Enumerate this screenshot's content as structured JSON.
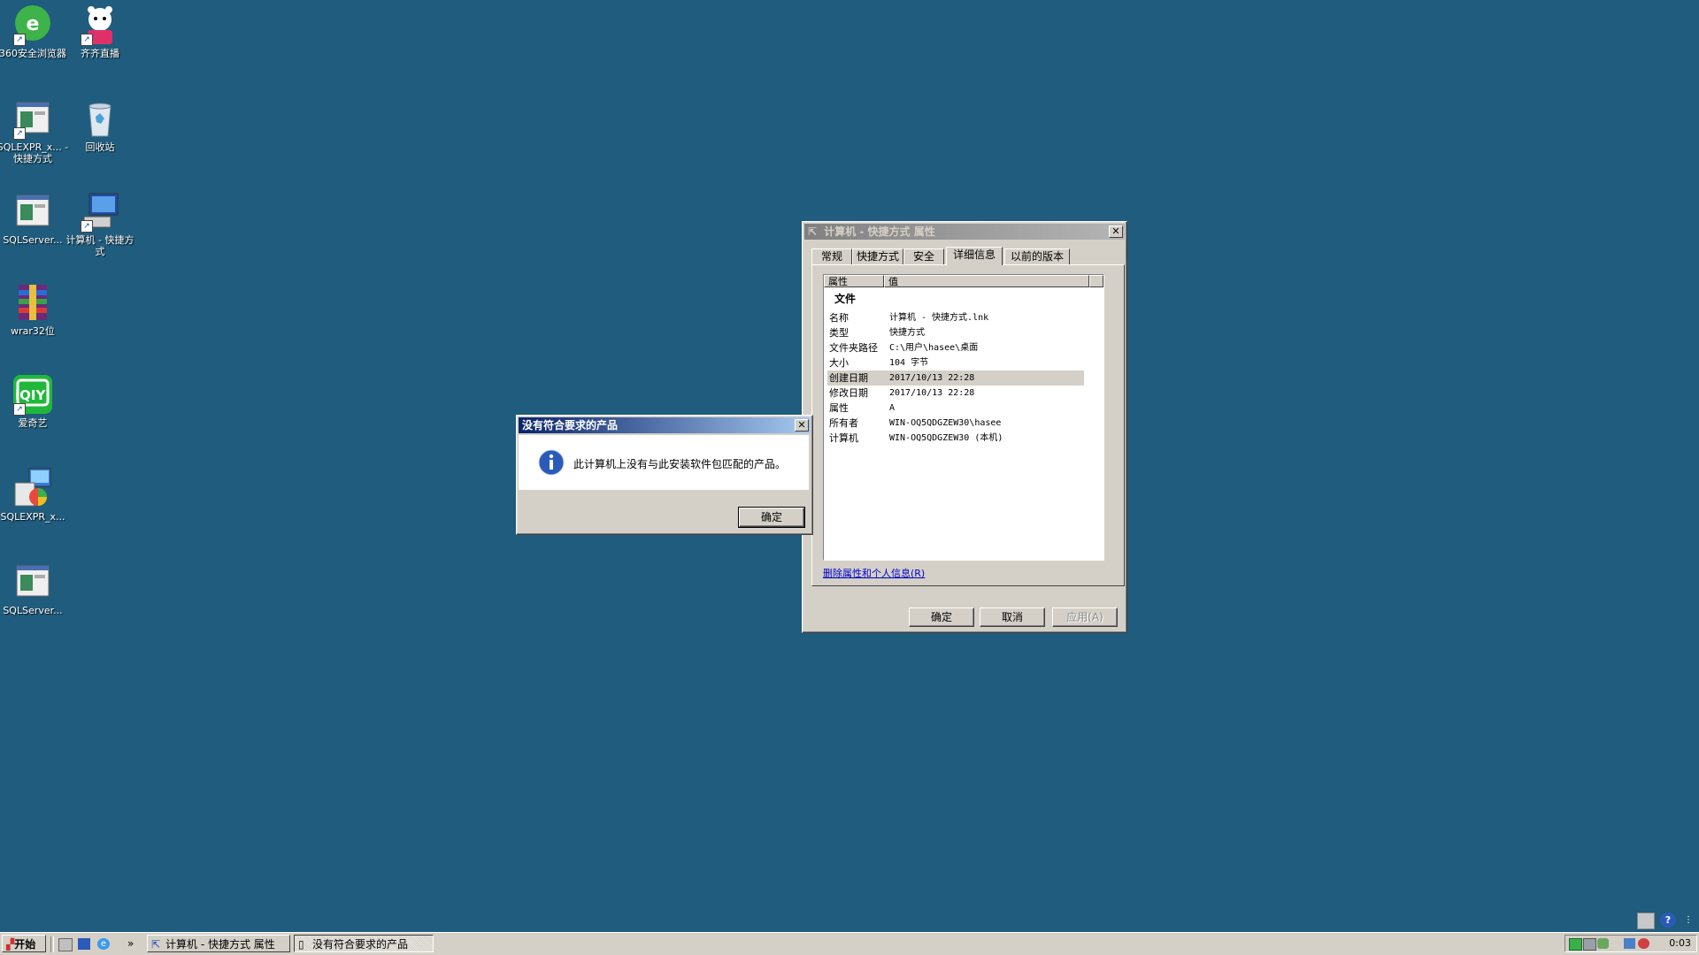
{
  "desktop": {
    "icons": [
      {
        "label": "360安全浏览器"
      },
      {
        "label": "齐齐直播"
      },
      {
        "label": "SQLEXPR_x... - 快捷方式"
      },
      {
        "label": "回收站"
      },
      {
        "label": "SQLServer..."
      },
      {
        "label": "计算机 - 快捷方式"
      },
      {
        "label": "wrar32位"
      },
      {
        "label": "爱奇艺"
      },
      {
        "label": "SQLEXPR_x..."
      },
      {
        "label": "SQLServer..."
      }
    ]
  },
  "props": {
    "title": "计算机 - 快捷方式 属性",
    "tabs": [
      "常规",
      "快捷方式",
      "安全",
      "详细信息",
      "以前的版本"
    ],
    "selected_tab": "详细信息",
    "columns": [
      "属性",
      "值"
    ],
    "group": "文件",
    "rows": [
      {
        "k": "名称",
        "v": "计算机 - 快捷方式.lnk"
      },
      {
        "k": "类型",
        "v": "快捷方式"
      },
      {
        "k": "文件夹路径",
        "v": "C:\\用户\\hasee\\桌面"
      },
      {
        "k": "大小",
        "v": "104 字节"
      },
      {
        "k": "创建日期",
        "v": "2017/10/13 22:28"
      },
      {
        "k": "修改日期",
        "v": "2017/10/13 22:28"
      },
      {
        "k": "属性",
        "v": "A"
      },
      {
        "k": "所有者",
        "v": "WIN-OQ5QDGZEW30\\hasee"
      },
      {
        "k": "计算机",
        "v": "WIN-OQ5QDGZEW30 (本机)"
      }
    ],
    "remove_link": "删除属性和个人信息(R)",
    "ok": "确定",
    "cancel": "取消",
    "apply": "应用(A)"
  },
  "msgbox": {
    "title": "没有符合要求的产品",
    "message": "此计算机上没有与此安装软件包匹配的产品。",
    "ok": "确定"
  },
  "taskbar": {
    "start": "开始",
    "chevron": "»",
    "tasks": [
      "计算机 - 快捷方式 属性",
      "没有符合要求的产品"
    ],
    "clock": "0:03"
  },
  "colors": {
    "desktop": "#1f5c7d",
    "titlebar_active": "#0a246a",
    "face": "#d4d0c8"
  }
}
